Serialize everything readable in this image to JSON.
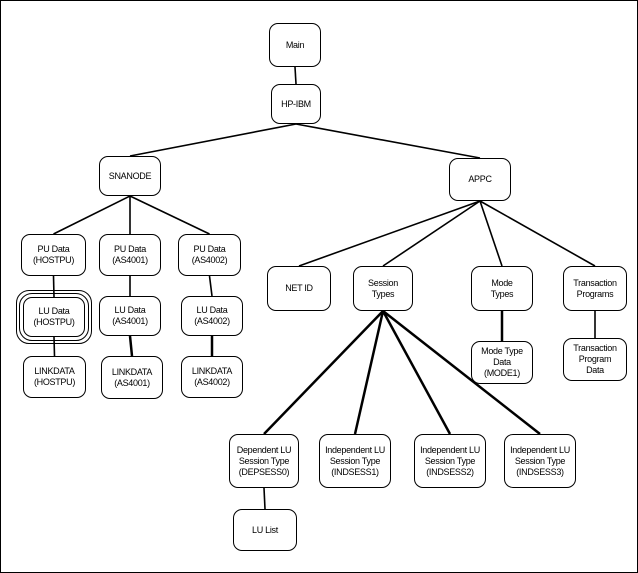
{
  "nodes": [
    {
      "id": "main",
      "label": "Main"
    },
    {
      "id": "hpibm",
      "label": "HP-IBM"
    },
    {
      "id": "snanode",
      "label": "SNANODE"
    },
    {
      "id": "appc",
      "label": "APPC"
    },
    {
      "id": "pu_hostpu",
      "label": "PU Data\n(HOSTPU)"
    },
    {
      "id": "pu_as4001",
      "label": "PU Data\n(AS4001)"
    },
    {
      "id": "pu_as4002",
      "label": "PU Data\n(AS4002)"
    },
    {
      "id": "lu_hostpu",
      "label": "LU Data\n(HOSTPU)",
      "selected": true
    },
    {
      "id": "lu_as4001",
      "label": "LU Data\n(AS4001)"
    },
    {
      "id": "lu_as4002",
      "label": "LU Data\n(AS4002)"
    },
    {
      "id": "link_hostpu",
      "label": "LINKDATA\n(HOSTPU)"
    },
    {
      "id": "link_as4001",
      "label": "LINKDATA\n(AS4001)"
    },
    {
      "id": "link_as4002",
      "label": "LINKDATA\n(AS4002)"
    },
    {
      "id": "netid",
      "label": "NET ID"
    },
    {
      "id": "session",
      "label": "Session\nTypes"
    },
    {
      "id": "mode",
      "label": "Mode\nTypes"
    },
    {
      "id": "tp",
      "label": "Transaction\nPrograms"
    },
    {
      "id": "modedata",
      "label": "Mode Type\nData\n(MODE1)"
    },
    {
      "id": "tpdata",
      "label": "Transaction\nProgram\nData"
    },
    {
      "id": "dep",
      "label": "Dependent LU\nSession Type\n(DEPSESS0)"
    },
    {
      "id": "ind1",
      "label": "Independent LU\nSession Type\n(INDSESS1)"
    },
    {
      "id": "ind2",
      "label": "Independent LU\nSession Type\n(INDSESS2)"
    },
    {
      "id": "ind3",
      "label": "Independent LU\nSession Type\n(INDSESS3)"
    },
    {
      "id": "lulist",
      "label": "LU List"
    }
  ],
  "edges": [
    [
      "main",
      "hpibm"
    ],
    [
      "hpibm",
      "snanode"
    ],
    [
      "hpibm",
      "appc"
    ],
    [
      "snanode",
      "pu_hostpu"
    ],
    [
      "snanode",
      "pu_as4001"
    ],
    [
      "snanode",
      "pu_as4002"
    ],
    [
      "pu_hostpu",
      "lu_hostpu"
    ],
    [
      "pu_as4001",
      "lu_as4001"
    ],
    [
      "pu_as4002",
      "lu_as4002"
    ],
    [
      "lu_hostpu",
      "link_hostpu"
    ],
    [
      "lu_as4001",
      "link_as4001"
    ],
    [
      "lu_as4002",
      "link_as4002"
    ],
    [
      "appc",
      "netid"
    ],
    [
      "appc",
      "session"
    ],
    [
      "appc",
      "mode"
    ],
    [
      "appc",
      "tp"
    ],
    [
      "mode",
      "modedata"
    ],
    [
      "tp",
      "tpdata"
    ],
    [
      "session",
      "dep"
    ],
    [
      "session",
      "ind1"
    ],
    [
      "session",
      "ind2"
    ],
    [
      "session",
      "ind3"
    ],
    [
      "dep",
      "lulist"
    ]
  ]
}
